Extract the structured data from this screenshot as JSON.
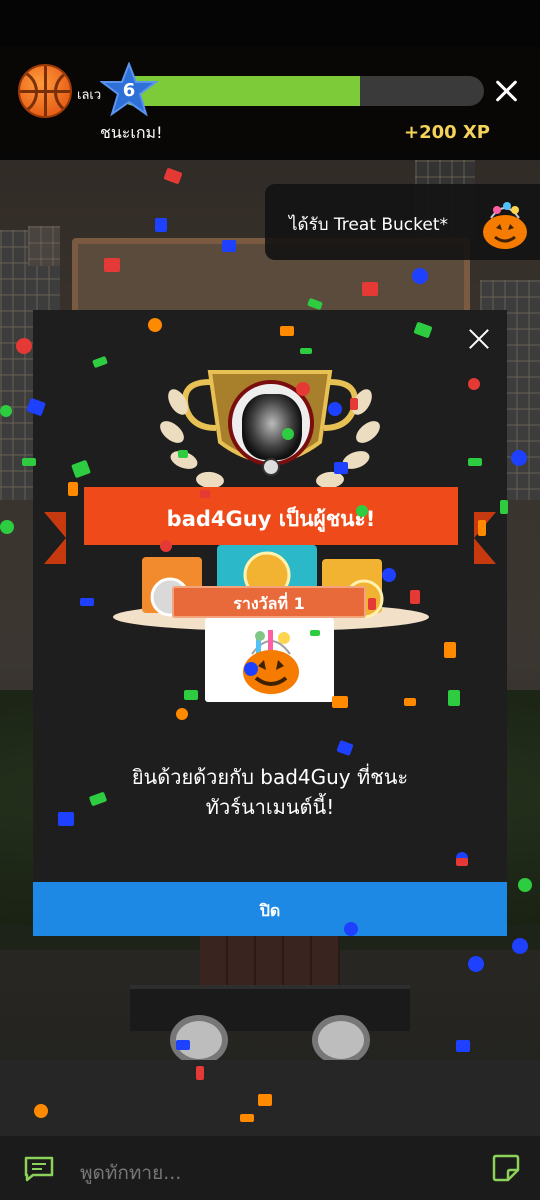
{
  "hud": {
    "level_label": "เลเว",
    "level": "6",
    "xp_progress": 0.66,
    "win_text": "ชนะเกม!",
    "xp_gain": "+200 XP"
  },
  "toast": {
    "text": "ได้รับ Treat Bucket*"
  },
  "modal": {
    "winner_banner": "bad4Guy เป็นผู้ชนะ!",
    "prize_label": "รางวัลที่ 1",
    "congrats_line1": "ยินด้วยด้วยกับ bad4Guy ที่ชนะ",
    "congrats_line2": "ทัวร์นาเมนต์นี้!",
    "close_button": "ปิด"
  },
  "chat": {
    "placeholder": "พูดทักทาย..."
  },
  "colors": {
    "accent_blue": "#1e88e5",
    "banner_orange": "#ef4a1a",
    "xp_green": "#7ecb3a",
    "xp_gold": "#f5d35a"
  },
  "icons": [
    "basketball-icon",
    "level-star-icon",
    "close-icon",
    "treat-bucket-icon",
    "trophy-icon",
    "chat-icon",
    "sticker-icon"
  ]
}
